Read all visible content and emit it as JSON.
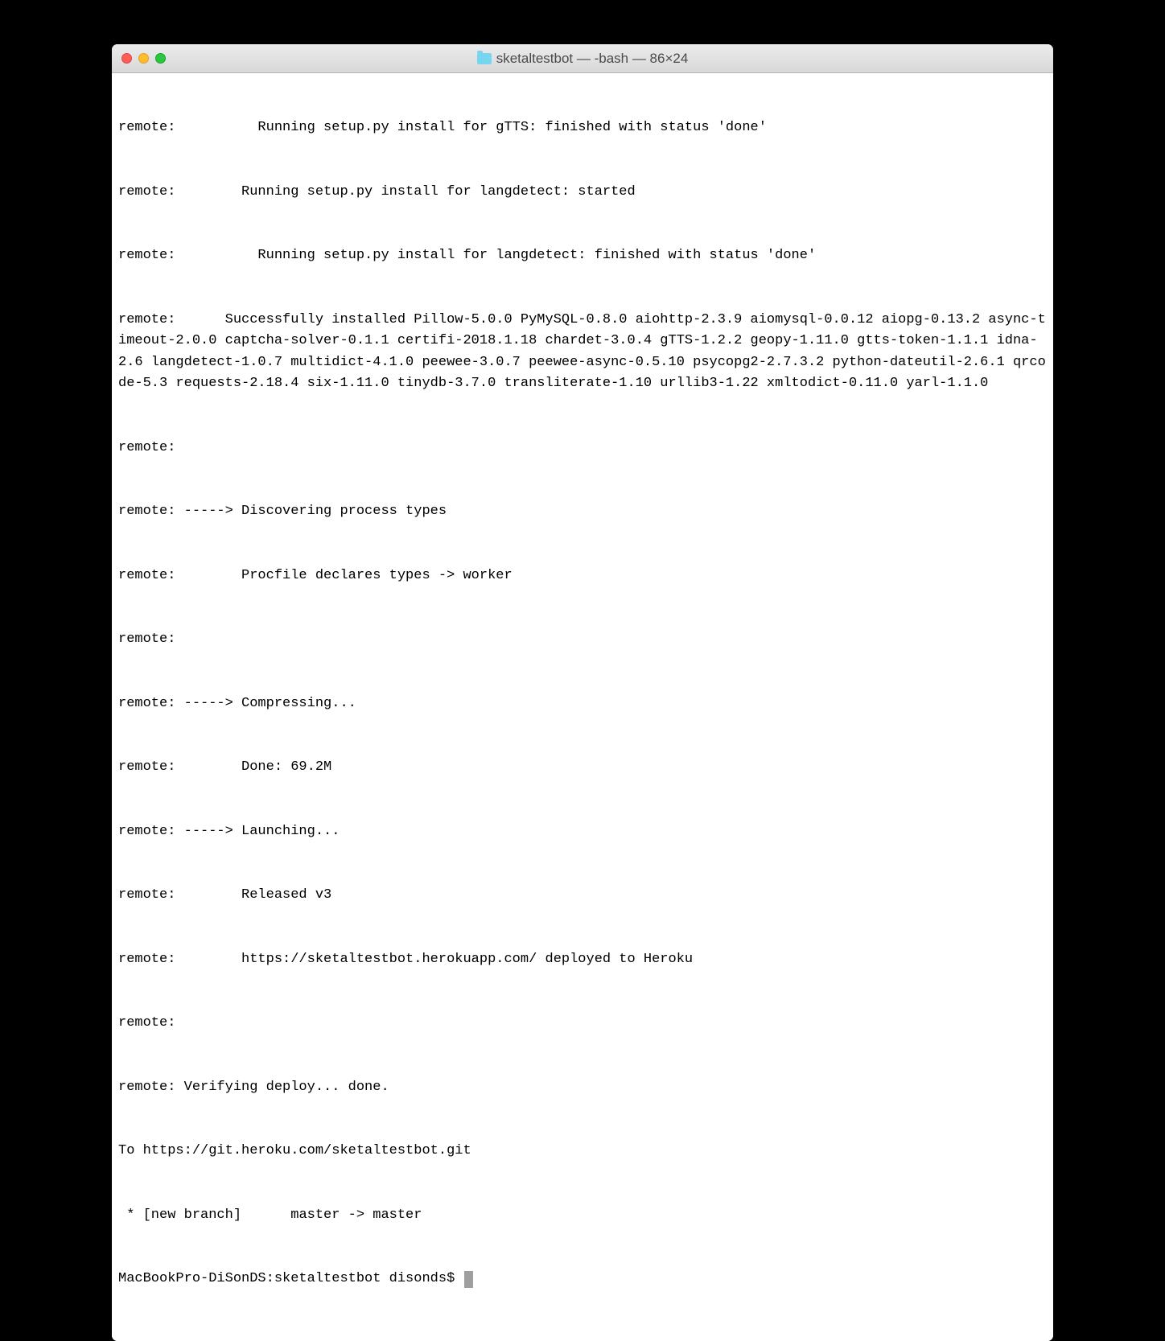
{
  "window": {
    "title": "sketaltestbot — -bash — 86×24"
  },
  "terminal": {
    "lines": [
      "remote:          Running setup.py install for gTTS: finished with status 'done'",
      "remote:        Running setup.py install for langdetect: started",
      "remote:          Running setup.py install for langdetect: finished with status 'done'",
      "remote:      Successfully installed Pillow-5.0.0 PyMySQL-0.8.0 aiohttp-2.3.9 aiomysql-0.0.12 aiopg-0.13.2 async-timeout-2.0.0 captcha-solver-0.1.1 certifi-2018.1.18 chardet-3.0.4 gTTS-1.2.2 geopy-1.11.0 gtts-token-1.1.1 idna-2.6 langdetect-1.0.7 multidict-4.1.0 peewee-3.0.7 peewee-async-0.5.10 psycopg2-2.7.3.2 python-dateutil-2.6.1 qrcode-5.3 requests-2.18.4 six-1.11.0 tinydb-3.7.0 transliterate-1.10 urllib3-1.22 xmltodict-0.11.0 yarl-1.1.0",
      "remote:",
      "remote: -----> Discovering process types",
      "remote:        Procfile declares types -> worker",
      "remote:",
      "remote: -----> Compressing...",
      "remote:        Done: 69.2M",
      "remote: -----> Launching...",
      "remote:        Released v3",
      "remote:        https://sketaltestbot.herokuapp.com/ deployed to Heroku",
      "remote:",
      "remote: Verifying deploy... done.",
      "To https://git.heroku.com/sketaltestbot.git",
      " * [new branch]      master -> master"
    ],
    "prompt": "MacBookPro-DiSonDS:sketaltestbot disonds$ "
  }
}
